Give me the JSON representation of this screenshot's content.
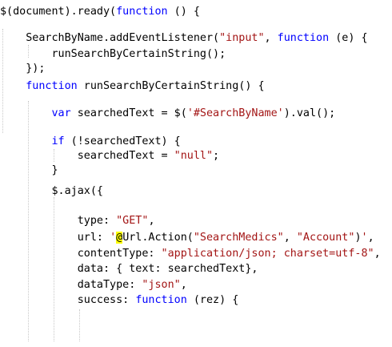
{
  "editor": {
    "lines": [
      [
        [
          "plain",
          "$(document).ready("
        ],
        [
          "kw",
          "function"
        ],
        [
          "plain",
          " () {"
        ]
      ],
      [],
      [
        [
          "plain",
          "    SearchByName.addEventListener("
        ],
        [
          "str",
          "\"input\""
        ],
        [
          "plain",
          ", "
        ],
        [
          "kw",
          "function"
        ],
        [
          "plain",
          " (e) {"
        ]
      ],
      [
        [
          "plain",
          "        runSearchByCertainString();"
        ]
      ],
      [
        [
          "plain",
          "    });"
        ]
      ],
      [
        [
          "plain",
          "    "
        ],
        [
          "kw",
          "function"
        ],
        [
          "plain",
          " runSearchByCertainString() {"
        ]
      ],
      [],
      [
        [
          "plain",
          "        "
        ],
        [
          "kw",
          "var"
        ],
        [
          "plain",
          " searchedText = $("
        ],
        [
          "str",
          "'#SearchByName'"
        ],
        [
          "plain",
          ").val();"
        ]
      ],
      [],
      [
        [
          "plain",
          "        "
        ],
        [
          "kw",
          "if"
        ],
        [
          "plain",
          " (!searchedText) {"
        ]
      ],
      [
        [
          "plain",
          "            searchedText = "
        ],
        [
          "str",
          "\"null\""
        ],
        [
          "plain",
          ";"
        ]
      ],
      [
        [
          "plain",
          "        }"
        ]
      ],
      [],
      [
        [
          "plain",
          "        $.ajax({"
        ]
      ],
      [],
      [
        [
          "plain",
          "            type: "
        ],
        [
          "str",
          "\"GET\""
        ],
        [
          "plain",
          ","
        ]
      ],
      [
        [
          "plain",
          "            url: "
        ],
        [
          "str",
          "'"
        ],
        [
          "razor",
          "@"
        ],
        [
          "plain",
          "Url.Action("
        ],
        [
          "str",
          "\"SearchMedics\""
        ],
        [
          "plain",
          ", "
        ],
        [
          "str",
          "\"Account\""
        ],
        [
          "plain",
          ")"
        ],
        [
          "str",
          "'"
        ],
        [
          "plain",
          ","
        ]
      ],
      [
        [
          "plain",
          "            contentType: "
        ],
        [
          "str",
          "\"application/json; charset=utf-8\""
        ],
        [
          "plain",
          ","
        ]
      ],
      [
        [
          "plain",
          "            data: { text: searchedText},"
        ]
      ],
      [
        [
          "plain",
          "            dataType: "
        ],
        [
          "str",
          "\"json\""
        ],
        [
          "plain",
          ","
        ]
      ],
      [
        [
          "plain",
          "            success: "
        ],
        [
          "kw",
          "function"
        ],
        [
          "plain",
          " (rez) {"
        ]
      ]
    ]
  },
  "colors": {
    "keyword": "#0000ff",
    "string": "#a31515",
    "plain": "#000000",
    "razor_highlight": "#ffff00",
    "indent_guide": "#c8c8c8",
    "background": "#ffffff"
  }
}
